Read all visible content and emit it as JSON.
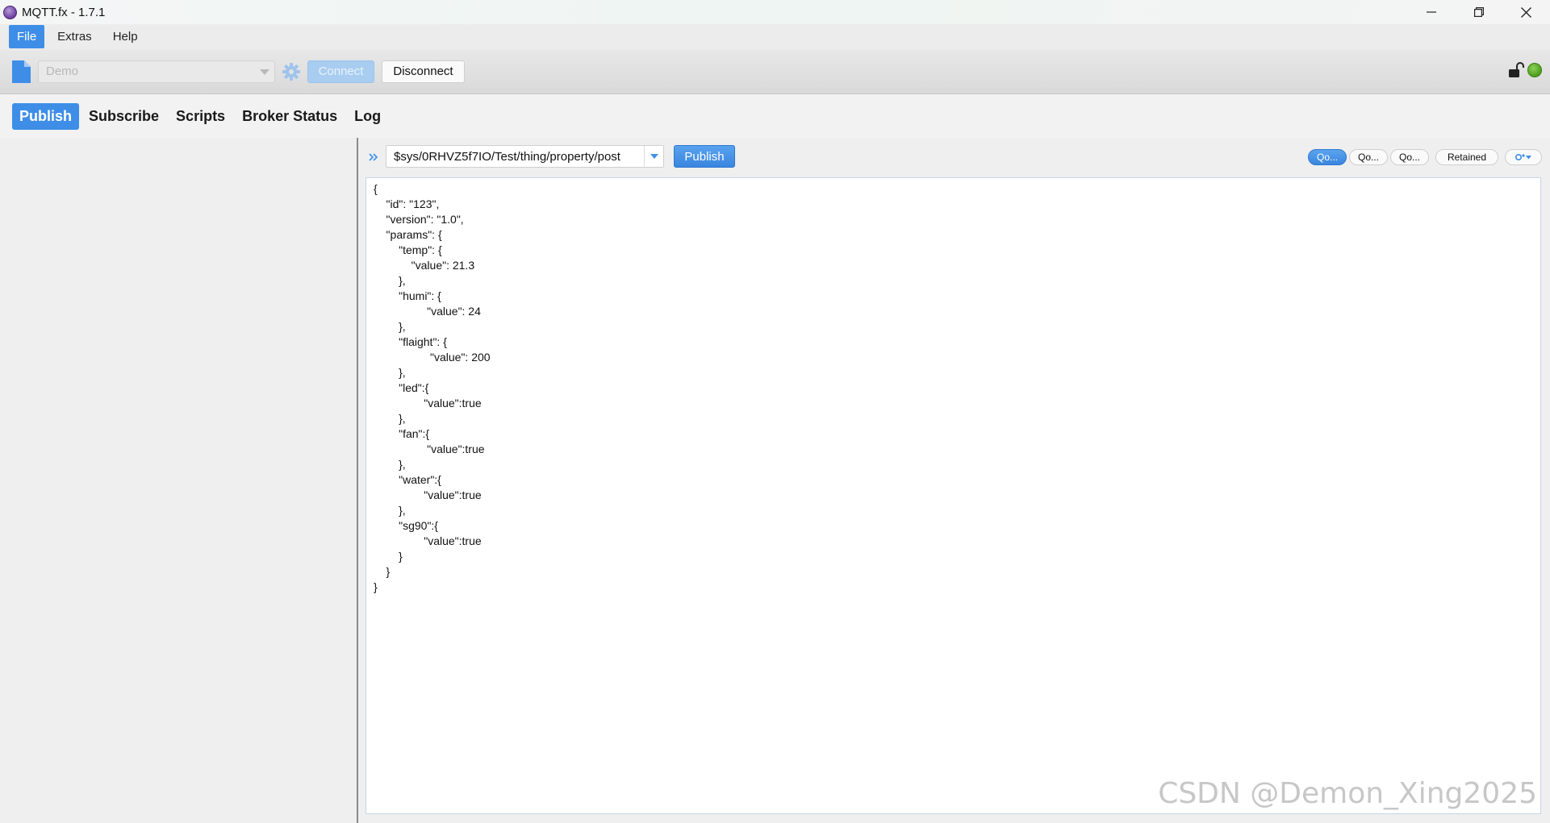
{
  "window": {
    "title": "MQTT.fx - 1.7.1",
    "controls": {
      "minimize": "─",
      "maximize": "❐",
      "close": "✕"
    }
  },
  "menu": {
    "items": [
      "File",
      "Extras",
      "Help"
    ]
  },
  "toolbar": {
    "profile_value": "Demo",
    "connect_label": "Connect",
    "disconnect_label": "Disconnect"
  },
  "tabs": {
    "items": [
      "Publish",
      "Subscribe",
      "Scripts",
      "Broker Status",
      "Log"
    ]
  },
  "publish": {
    "topic_value": "$sys/0RHVZ5f7IO/Test/thing/property/post",
    "publish_label": "Publish",
    "qos": [
      "Qo...",
      "Qo...",
      "Qo..."
    ],
    "retained_label": "Retained",
    "payload": "{\n    \"id\": \"123\",\n    \"version\": \"1.0\",\n    \"params\": {\n        \"temp\": {\n            \"value\": 21.3\n        },\n        \"humi\": {\n                 \"value\": 24\n        },\n        \"flaight\": {\n                  \"value\": 200\n        },\n        \"led\":{\n                \"value\":true\n        },\n        \"fan\":{\n                 \"value\":true\n        },\n        \"water\":{\n                \"value\":true\n        },\n        \"sg90\":{\n                \"value\":true\n        }\n    }\n}"
  },
  "watermark": "CSDN @Demon_Xing2025",
  "colors": {
    "accent": "#3e8ee8",
    "status_led": "#4d9e1c"
  }
}
